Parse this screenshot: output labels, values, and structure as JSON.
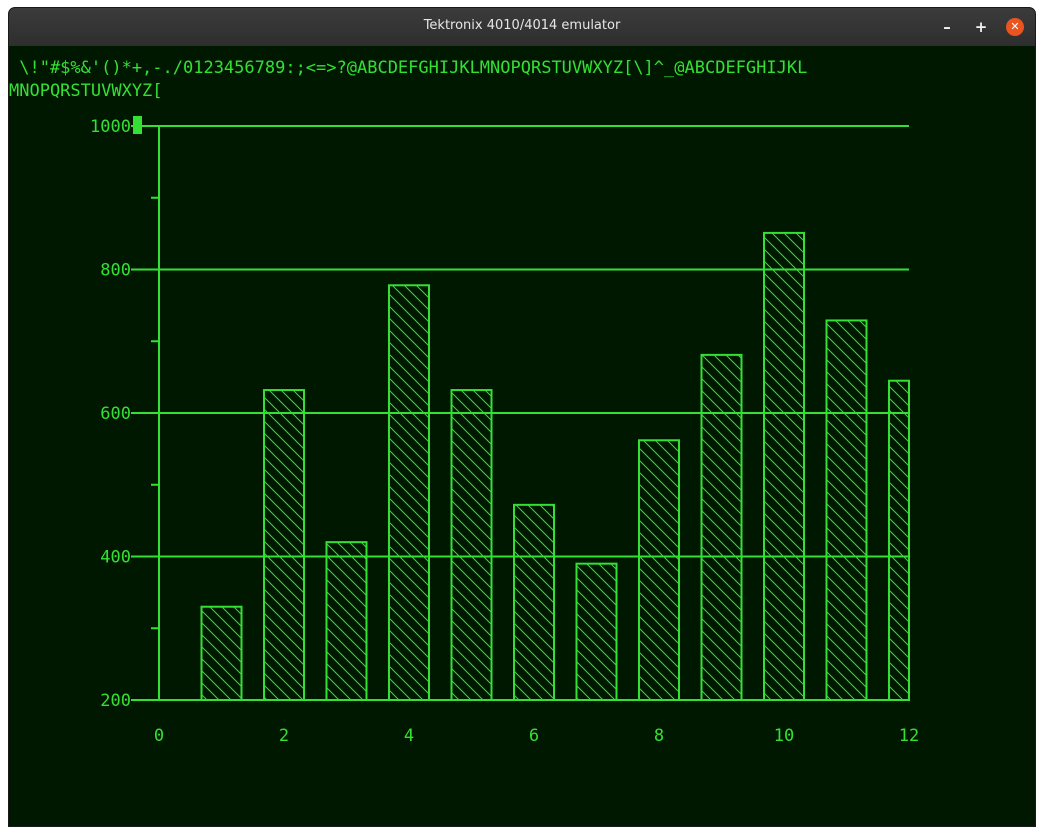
{
  "window": {
    "title": "Tektronix 4010/4014 emulator",
    "minimize_glyph": "–",
    "maximize_glyph": "+",
    "close_glyph": "✕"
  },
  "terminal": {
    "line1": " \\!\"#$%&'()*+,-./0123456789:;<=>?@ABCDEFGHIJKLMNOPQRSTUVWXYZ[\\]^_@ABCDEFGHIJKL",
    "line2": "MNOPQRSTUVWXYZ["
  },
  "colors": {
    "phosphor": "#33e033",
    "background": "#001800"
  },
  "chart_data": {
    "type": "bar",
    "title": "",
    "xlabel": "",
    "ylabel": "",
    "fill": "hatched",
    "x": [
      1,
      2,
      3,
      4,
      5,
      6,
      7,
      8,
      9,
      10,
      11,
      12
    ],
    "values": [
      330,
      632,
      420,
      778,
      632,
      472,
      390,
      562,
      681,
      851,
      729,
      645
    ],
    "xlim": [
      0,
      12
    ],
    "ylim": [
      200,
      1000
    ],
    "xticks": [
      0,
      2,
      4,
      6,
      8,
      10,
      12
    ],
    "yticks": [
      200,
      400,
      600,
      800,
      1000
    ],
    "grid": "horizontal"
  }
}
